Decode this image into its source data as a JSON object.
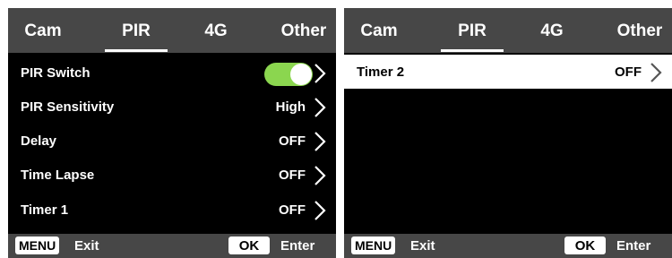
{
  "left_screen": {
    "tabs": [
      {
        "label": "Cam"
      },
      {
        "label": "PIR"
      },
      {
        "label": "4G"
      },
      {
        "label": "Other"
      }
    ],
    "active_tab": "PIR",
    "rows": [
      {
        "label": "PIR Switch",
        "value": "",
        "toggle_on": true
      },
      {
        "label": "PIR Sensitivity",
        "value": "High"
      },
      {
        "label": "Delay",
        "value": "OFF"
      },
      {
        "label": "Time Lapse",
        "value": "OFF"
      },
      {
        "label": "Timer 1",
        "value": "OFF"
      }
    ],
    "footer": {
      "menu_key": "MENU",
      "exit_label": "Exit",
      "ok_key": "OK",
      "enter_label": "Enter"
    }
  },
  "right_screen": {
    "tabs": [
      {
        "label": "Cam"
      },
      {
        "label": "PIR"
      },
      {
        "label": "4G"
      },
      {
        "label": "Other"
      }
    ],
    "active_tab": "PIR",
    "rows": [
      {
        "label": "Timer 2",
        "value": "OFF",
        "selected": true
      }
    ],
    "footer": {
      "menu_key": "MENU",
      "exit_label": "Exit",
      "ok_key": "OK",
      "enter_label": "Enter"
    }
  },
  "colors": {
    "bar_gray": "#474747",
    "screen_black": "#000000",
    "toggle_green": "#8bd64f",
    "text_white": "#ffffff"
  }
}
